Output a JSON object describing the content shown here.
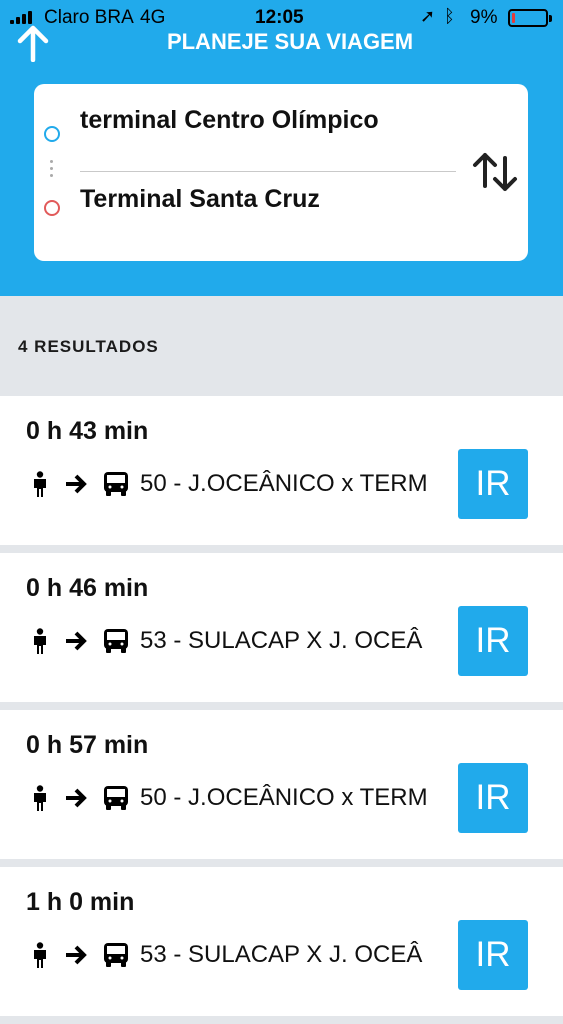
{
  "status_bar": {
    "carrier": "Claro BRA",
    "network": "4G",
    "time": "12:05",
    "battery_percent": "9%",
    "battery_level": 0.09,
    "battery_color": "#e33b3b",
    "icons": [
      "signal-icon",
      "location-icon",
      "bluetooth-icon",
      "battery-icon"
    ]
  },
  "header": {
    "title": "PLANEJE SUA VIAGEM",
    "back_icon": "arrow-up-icon",
    "background_color": "#21aaeb"
  },
  "route_card": {
    "origin": "terminal Centro Olímpico",
    "destination": "Terminal Santa Cruz",
    "swap_icon": "swap-vertical-icon"
  },
  "results": {
    "count_label": "4 RESULTADOS",
    "items": [
      {
        "duration": "0 h 43 min",
        "route": "50 - J.OCEÂNICO x TERM",
        "button_label": "IR"
      },
      {
        "duration": "0 h 46 min",
        "route": "53 - SULACAP X J. OCEÂ",
        "button_label": "IR"
      },
      {
        "duration": "0 h 57 min",
        "route": "50 - J.OCEÂNICO x TERM",
        "button_label": "IR"
      },
      {
        "duration": "1 h 0 min",
        "route": "53 - SULACAP X J. OCEÂ",
        "button_label": "IR"
      }
    ]
  },
  "colors": {
    "accent": "#21aaeb",
    "origin_marker": "#21aaeb",
    "destination_marker": "#e15a5a",
    "list_background": "#e3e6ea"
  }
}
